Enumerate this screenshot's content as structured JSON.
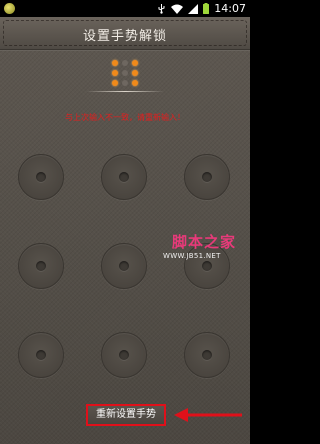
{
  "status_bar": {
    "time": "14:07",
    "icons": [
      "usb-icon",
      "wifi-icon",
      "signal-icon",
      "battery-icon"
    ]
  },
  "header": {
    "title": "设置手势解锁"
  },
  "preview": {
    "active_dots": [
      0,
      2,
      3,
      5,
      6,
      8
    ]
  },
  "message": {
    "error": "与上次输入不一致，请重新输入！",
    "error_color": "#e21e1e"
  },
  "pattern": {
    "rows": 3,
    "cols": 3
  },
  "watermark": {
    "main": "脚本之家",
    "sub": "WWW.JB51.NET"
  },
  "footer": {
    "reset_label": "重新设置手势",
    "highlight_color": "#e0101a"
  }
}
